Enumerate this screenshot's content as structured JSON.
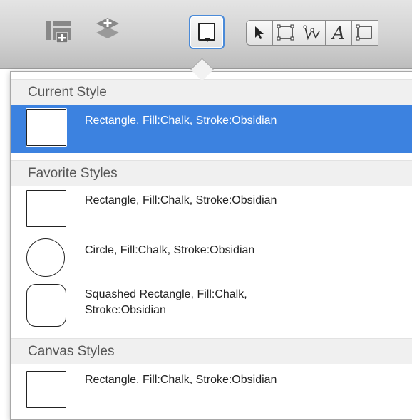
{
  "toolbar": {
    "icons": [
      "grid-add-icon",
      "layers-icon",
      "style-popup-button",
      "select-arrow-icon",
      "shape-rectangle-icon",
      "bezier-icon",
      "text-tool-icon",
      "shape-rectangle-icon"
    ],
    "text_tool_glyph": "A"
  },
  "popover": {
    "current_style": {
      "header": "Current Style",
      "items": [
        {
          "label": "Rectangle, Fill:Chalk, Stroke:Obsidian",
          "shape": "rectangle"
        }
      ]
    },
    "favorite_styles": {
      "header": "Favorite Styles",
      "items": [
        {
          "label": "Rectangle, Fill:Chalk, Stroke:Obsidian",
          "shape": "rectangle"
        },
        {
          "label": "Circle, Fill:Chalk, Stroke:Obsidian",
          "shape": "circle"
        },
        {
          "label": "Squashed Rectangle, Fill:Chalk, Stroke:Obsidian",
          "shape": "squashed-rectangle"
        }
      ]
    },
    "canvas_styles": {
      "header": "Canvas Styles",
      "items": [
        {
          "label": "Rectangle, Fill:Chalk, Stroke:Obsidian",
          "shape": "rectangle"
        }
      ]
    }
  },
  "colors": {
    "selection": "#3c82e0",
    "section_header_bg": "#f0f0f0",
    "stroke": "#222222",
    "fill": "#ffffff"
  }
}
